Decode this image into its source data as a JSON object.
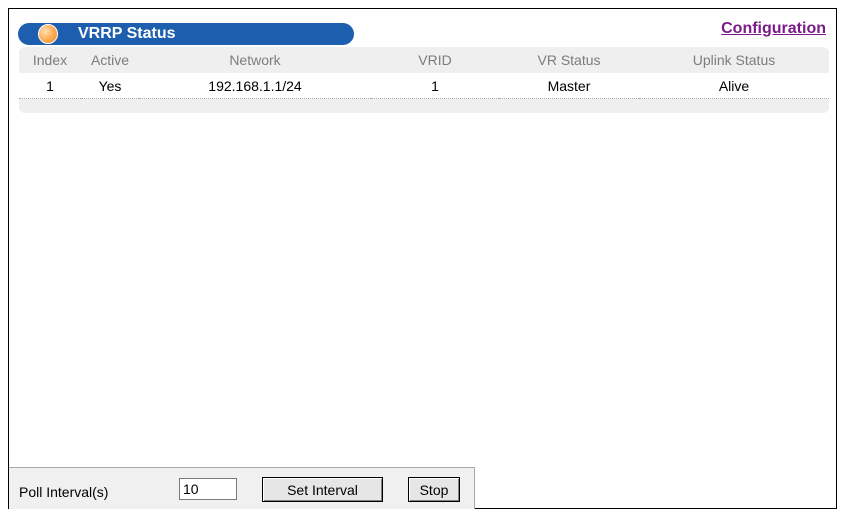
{
  "header": {
    "title": "VRRP Status",
    "config_link": "Configuration"
  },
  "table": {
    "columns": [
      "Index",
      "Active",
      "Network",
      "VRID",
      "VR Status",
      "Uplink Status"
    ],
    "rows": [
      [
        "1",
        "Yes",
        "192.168.1.1/24",
        "1",
        "Master",
        "Alive"
      ]
    ]
  },
  "poll": {
    "label": "Poll Interval(s)",
    "value": "10",
    "set_label": "Set Interval",
    "stop_label": "Stop"
  },
  "colors": {
    "title_bar": "#1d5fae",
    "link": "#7a1c88",
    "header_text": "#7c7c7c",
    "table_bg": "#efefef"
  }
}
